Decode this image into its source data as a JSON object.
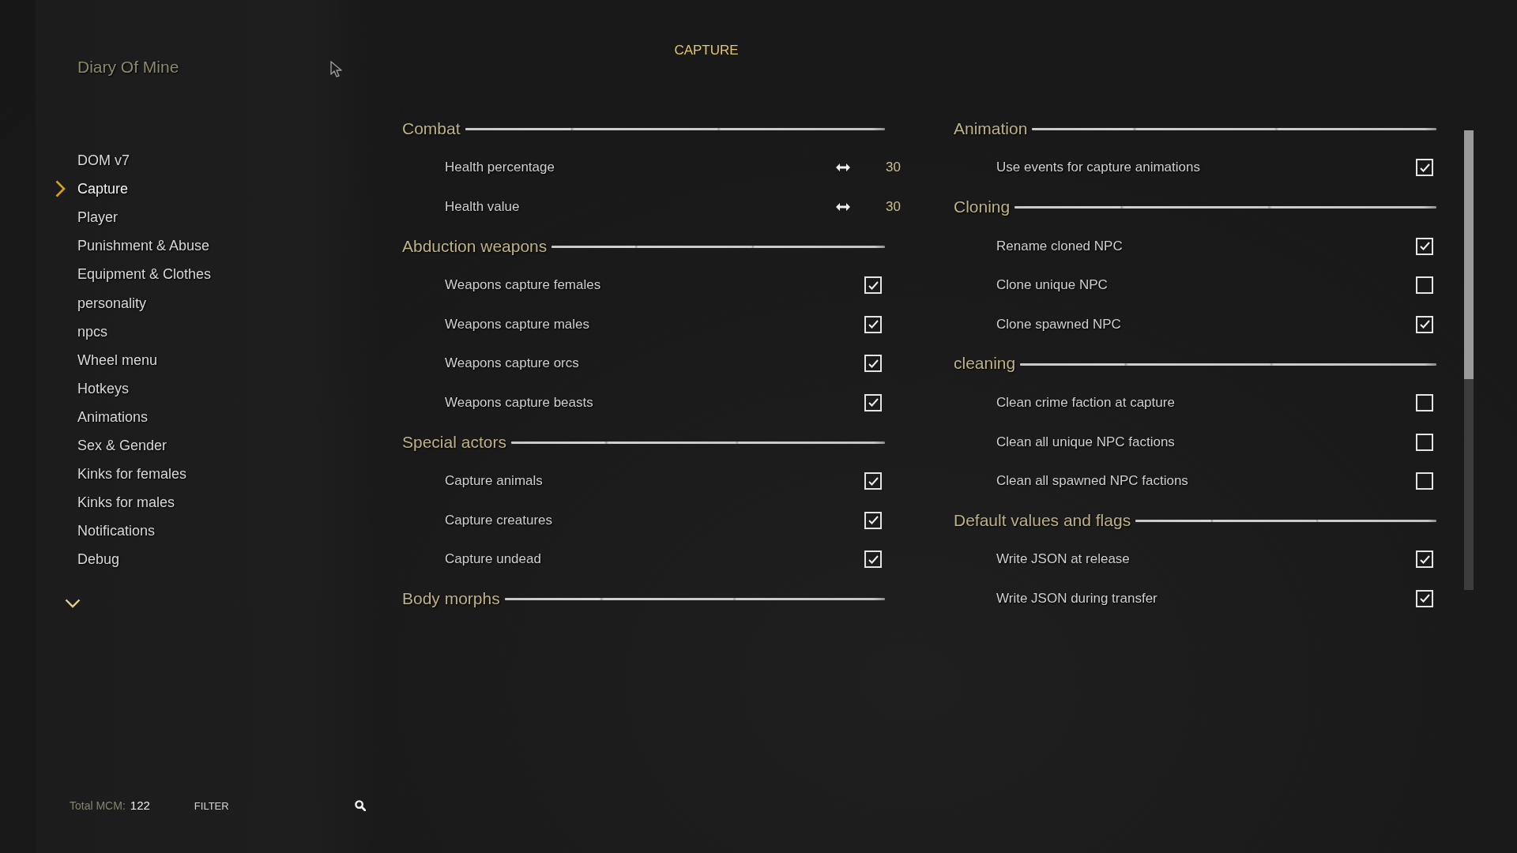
{
  "sidebar": {
    "title": "Diary Of Mine",
    "items": [
      {
        "label": "DOM v7",
        "selected": false
      },
      {
        "label": "Capture",
        "selected": true
      },
      {
        "label": "Player",
        "selected": false
      },
      {
        "label": "Punishment & Abuse",
        "selected": false
      },
      {
        "label": "Equipment & Clothes",
        "selected": false
      },
      {
        "label": "personality",
        "selected": false
      },
      {
        "label": "npcs",
        "selected": false
      },
      {
        "label": "Wheel menu",
        "selected": false
      },
      {
        "label": "Hotkeys",
        "selected": false
      },
      {
        "label": "Animations",
        "selected": false
      },
      {
        "label": "Sex & Gender",
        "selected": false
      },
      {
        "label": "Kinks for females",
        "selected": false
      },
      {
        "label": "Kinks for males",
        "selected": false
      },
      {
        "label": "Notifications",
        "selected": false
      },
      {
        "label": "Debug",
        "selected": false
      }
    ]
  },
  "page": {
    "title": "CAPTURE"
  },
  "columns": [
    {
      "sections": [
        {
          "title": "Combat",
          "settings": [
            {
              "kind": "slider",
              "label": "Health percentage",
              "value": "30"
            },
            {
              "kind": "slider",
              "label": "Health value",
              "value": "30"
            }
          ]
        },
        {
          "title": "Abduction weapons",
          "settings": [
            {
              "kind": "toggle",
              "label": "Weapons capture females",
              "checked": true
            },
            {
              "kind": "toggle",
              "label": "Weapons capture males",
              "checked": true
            },
            {
              "kind": "toggle",
              "label": "Weapons capture orcs",
              "checked": true
            },
            {
              "kind": "toggle",
              "label": "Weapons capture beasts",
              "checked": true
            }
          ]
        },
        {
          "title": "Special actors",
          "settings": [
            {
              "kind": "toggle",
              "label": "Capture animals",
              "checked": true
            },
            {
              "kind": "toggle",
              "label": "Capture creatures",
              "checked": true
            },
            {
              "kind": "toggle",
              "label": "Capture undead",
              "checked": true
            }
          ]
        },
        {
          "title": "Body morphs"
        }
      ]
    },
    {
      "sections": [
        {
          "title": "Animation",
          "settings": [
            {
              "kind": "toggle",
              "label": "Use events for capture animations",
              "checked": true
            }
          ]
        },
        {
          "title": "Cloning",
          "settings": [
            {
              "kind": "toggle",
              "label": "Rename cloned NPC",
              "checked": true
            },
            {
              "kind": "toggle",
              "label": "Clone unique NPC",
              "checked": false
            },
            {
              "kind": "toggle",
              "label": "Clone spawned NPC",
              "checked": true
            }
          ]
        },
        {
          "title": "cleaning",
          "settings": [
            {
              "kind": "toggle",
              "label": "Clean crime faction at capture",
              "checked": false
            },
            {
              "kind": "toggle",
              "label": "Clean all unique NPC factions",
              "checked": false
            },
            {
              "kind": "toggle",
              "label": "Clean all spawned NPC factions",
              "checked": false
            }
          ]
        },
        {
          "title": "Default values and flags",
          "settings": [
            {
              "kind": "toggle",
              "label": "Write JSON at release",
              "checked": true
            },
            {
              "kind": "toggle",
              "label": "Write JSON during transfer",
              "checked": true
            }
          ]
        }
      ]
    }
  ],
  "footer": {
    "total_label": "Total MCM:",
    "total": "122",
    "filter": {
      "placeholder": "FILTER"
    }
  }
}
